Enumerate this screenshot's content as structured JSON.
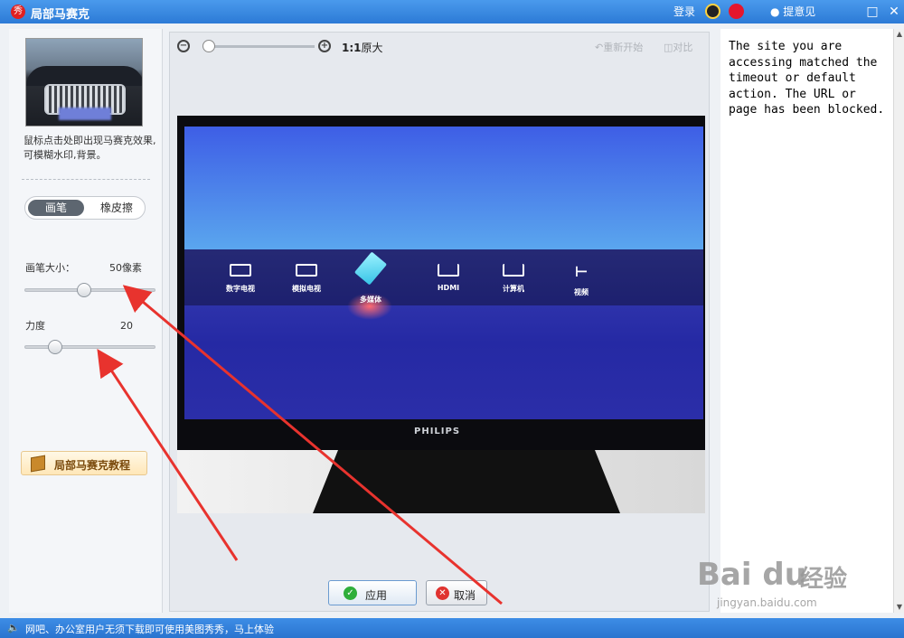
{
  "titlebar": {
    "app_title": "局部马赛克",
    "login": "登录",
    "feedback": "提意见",
    "app_icon_char": "秀"
  },
  "left": {
    "description": "鼠标点击处即出现马赛克效果,可模糊水印,背景。",
    "tab_brush": "画笔",
    "tab_eraser": "橡皮擦",
    "brush_size_label": "画笔大小：",
    "brush_size_value": "50像素",
    "brush_size_level": 0.45,
    "strength_label": "力度",
    "strength_value": "20",
    "strength_level": 0.2,
    "tutorial_label": "局部马赛克教程"
  },
  "canvas": {
    "zoom_out": "−",
    "zoom_in": "+",
    "ratio_strong": "1:1",
    "ratio_text": "原大",
    "restart": "重新开始",
    "compare": "对比",
    "brand": "PHILIPS",
    "inputs": [
      "数字电视",
      "模拟电视",
      "多媒体",
      "HDMI",
      "计算机",
      "视频"
    ]
  },
  "buttons": {
    "apply": "应用",
    "cancel": "取消"
  },
  "right": {
    "blocked_message": "The site you are accessing matched the timeout or default action. The URL or page has been blocked."
  },
  "watermark": {
    "logo": "Bai du",
    "cn": "经验",
    "url": "jingyan.baidu.com"
  },
  "statusbar": {
    "text": "网吧、办公室用户无须下载即可使用美图秀秀，马上体验"
  },
  "colors": {
    "annotation_arrow": "#e8332e",
    "titlebar": "#2c7ad6",
    "screen_blue": "#2529a4"
  }
}
